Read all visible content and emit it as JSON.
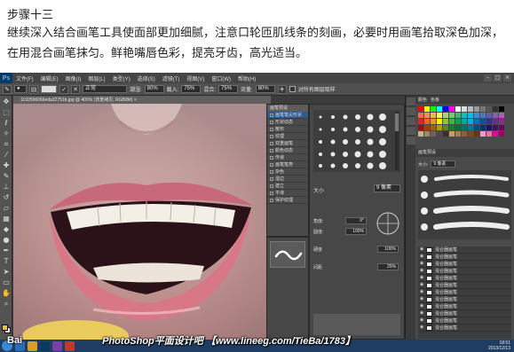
{
  "article": {
    "step_title": "步骤十三",
    "description": "继续深入结合画笔工具使面部更加细腻，注意口轮匝肌线条的刻画，必要时用画笔拾取深色加深，在用混合画笔抹匀。鲜艳嘴唇色彩，提亮牙齿，高光适当。"
  },
  "photoshop": {
    "logo": "Ps",
    "menus": [
      "文件(F)",
      "编辑(E)",
      "图像(I)",
      "图层(L)",
      "类型(Y)",
      "选择(S)",
      "滤镜(T)",
      "视图(V)",
      "窗口(W)",
      "帮助(H)"
    ],
    "window_controls": [
      "–",
      "□",
      "×"
    ],
    "options": {
      "mode_label": "模式:",
      "mode_value": "正常",
      "opacity_label": "不透明度:",
      "opacity_value": "80%",
      "flow_label": "流量:",
      "flow_value": "25%",
      "mix_label": "混合:",
      "mix_value": "75%",
      "wet_label": "潮湿:",
      "wet_value": "80%",
      "load_label": "载入:",
      "load_value": "75%",
      "sample_label": "对所有图层取样"
    },
    "document_tab": "1192596066eda22751b.jpg @ 400% (背景拷贝, RGB/8#) ×",
    "brush_presets_panel": {
      "title": "画笔预设",
      "items": [
        "画笔笔尖形状",
        "形状动态",
        "散布",
        "纹理",
        "双重画笔",
        "颜色动态",
        "传递",
        "画笔笔势",
        "杂色",
        "湿边",
        "建立",
        "平滑",
        "保护纹理"
      ],
      "size_label": "大小",
      "size_value": "9 像素",
      "angle_label": "角度:",
      "angle_value": "0°",
      "roundness_label": "圆度:",
      "roundness_value": "100%",
      "hardness_label": "硬度",
      "hardness_value": "100%",
      "spacing_label": "间距",
      "spacing_value": "25%"
    },
    "right_panel": {
      "tabs": [
        "颜色",
        "色板"
      ],
      "brushes_header": "画笔预设",
      "size_label": "大小:",
      "size_value": "9 像素",
      "layer_name": "混合器画笔",
      "layer_count": 12
    },
    "clock": {
      "time": "18:51",
      "date": "2013/12/13"
    }
  },
  "watermark": {
    "brand": "Bai",
    "text": "PhotoShop平面设计吧 【www.lineeg.com/TieBa/1783】"
  },
  "colors": {
    "ui_dark": "#3c3c3c",
    "panel": "#4a4a4a",
    "selection": "#2f5a8c",
    "taskbar": "#1f3d63",
    "foreground_color": "#e8c23a",
    "background_color": "#f5efd8"
  }
}
